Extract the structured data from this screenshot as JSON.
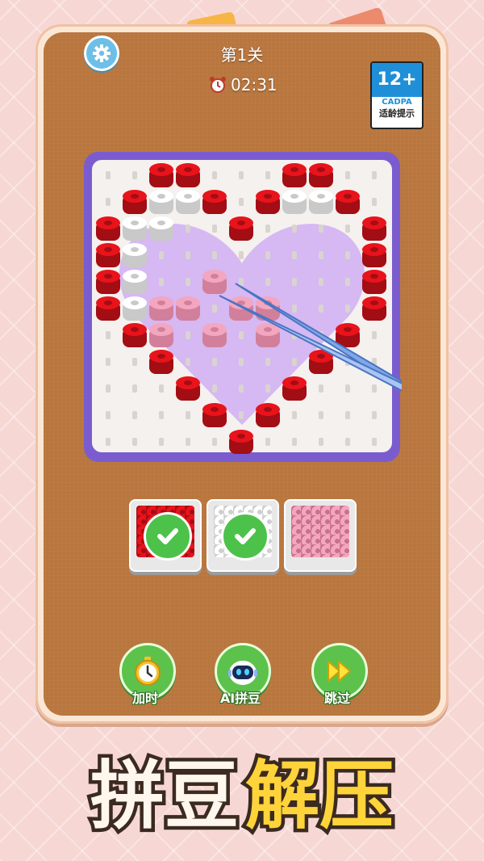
{
  "header": {
    "level_label": "第1关",
    "timer": "02:31",
    "age_rating": {
      "number": "12+",
      "org": "CADPA",
      "caption": "适龄提示"
    }
  },
  "trays": [
    {
      "color": "#e8131b",
      "completed": true
    },
    {
      "color": "#ffffff",
      "completed": true
    },
    {
      "color": "#f3a6bf",
      "completed": false
    }
  ],
  "powerups": [
    {
      "label": "加时",
      "icon": "stopwatch-icon"
    },
    {
      "label": "AI拼豆",
      "icon": "robot-icon"
    },
    {
      "label": "跳过",
      "icon": "fast-forward-icon"
    }
  ],
  "banner": {
    "part1": "拼豆",
    "part2": "解压"
  },
  "colors": {
    "red": "#e8131b",
    "white": "#ffffff",
    "pink": "#f3a6bf",
    "board": "#b9773f",
    "pegboard_border": "#7b5ccf",
    "heart_fill": "#d6b8f2"
  }
}
